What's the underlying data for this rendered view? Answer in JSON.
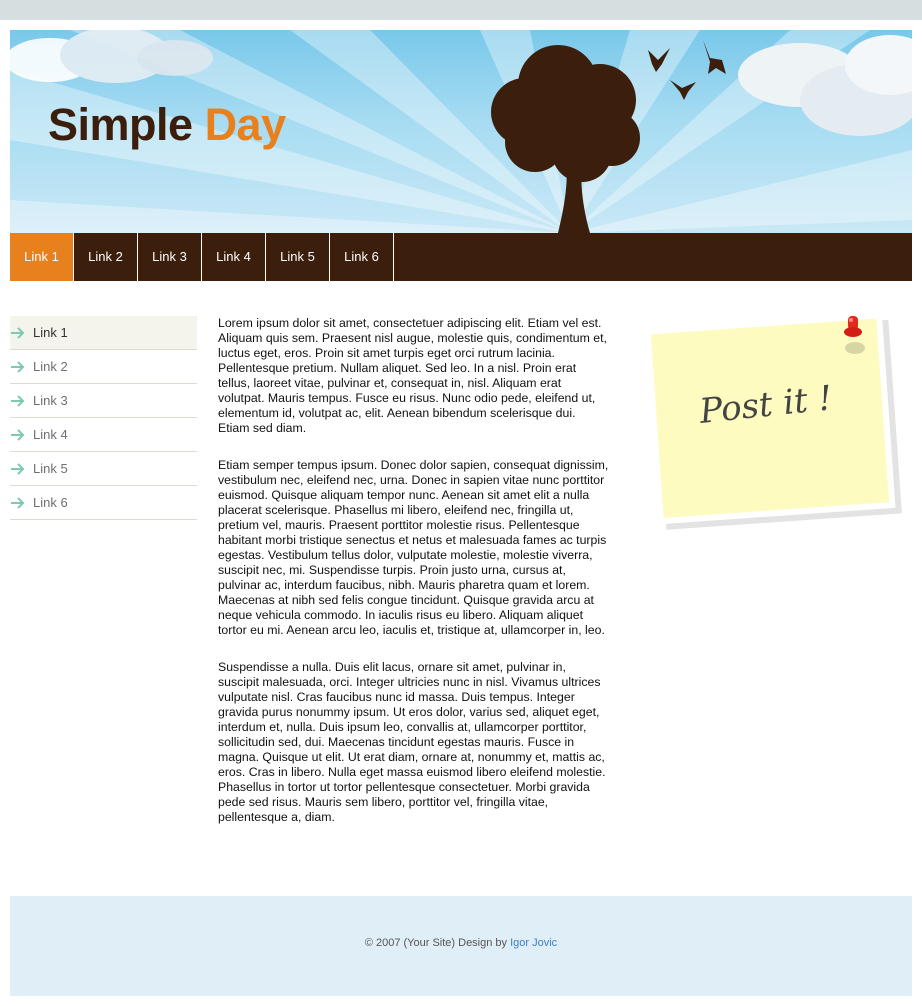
{
  "header": {
    "title_part1": "Simple",
    "title_part2": "Day",
    "colors": {
      "title_dark": "#3b1e0c",
      "title_accent": "#e8801e",
      "sky": "#79c8ea"
    },
    "decorations": [
      "sun-rays",
      "cloud-icon",
      "tree-icon",
      "bird-icon"
    ]
  },
  "nav": {
    "items": [
      {
        "label": "Link 1",
        "active": true
      },
      {
        "label": "Link 2",
        "active": false
      },
      {
        "label": "Link 3",
        "active": false
      },
      {
        "label": "Link 4",
        "active": false
      },
      {
        "label": "Link 5",
        "active": false
      },
      {
        "label": "Link 6",
        "active": false
      }
    ],
    "colors": {
      "bar": "#3b1e0c",
      "active": "#e8801e"
    }
  },
  "sidebar": {
    "items": [
      {
        "label": "Link 1",
        "active": true
      },
      {
        "label": "Link 2",
        "active": false
      },
      {
        "label": "Link 3",
        "active": false
      },
      {
        "label": "Link 4",
        "active": false
      },
      {
        "label": "Link 5",
        "active": false
      },
      {
        "label": "Link 6",
        "active": false
      }
    ],
    "icon": "arrow-right-icon"
  },
  "content": {
    "paragraphs": [
      "Lorem ipsum dolor sit amet, consectetuer adipiscing elit. Etiam vel est. Aliquam quis sem. Praesent nisl augue, molestie quis, condimentum et, luctus eget, eros. Proin sit amet turpis eget orci rutrum lacinia. Pellentesque pretium. Nullam aliquet. Sed leo. In a nisl. Proin erat tellus, laoreet vitae, pulvinar et, consequat in, nisl. Aliquam erat volutpat. Mauris tempus. Fusce eu risus. Nunc odio pede, eleifend ut, elementum id, volutpat ac, elit. Aenean bibendum scelerisque dui. Etiam sed diam.",
      "Etiam semper tempus ipsum. Donec dolor sapien, consequat dignissim, vestibulum nec, eleifend nec, urna. Donec in sapien vitae nunc porttitor euismod. Quisque aliquam tempor nunc. Aenean sit amet elit a nulla placerat scelerisque. Phasellus mi libero, eleifend nec, fringilla ut, pretium vel, mauris. Praesent porttitor molestie risus. Pellentesque habitant morbi tristique senectus et netus et malesuada fames ac turpis egestas. Vestibulum tellus dolor, vulputate molestie, molestie viverra, suscipit nec, mi. Suspendisse turpis. Proin justo urna, cursus at, pulvinar ac, interdum faucibus, nibh. Mauris pharetra quam et lorem. Maecenas at nibh sed felis congue tincidunt. Quisque gravida arcu at neque vehicula commodo. In iaculis risus eu libero. Aliquam aliquet tortor eu mi. Aenean arcu leo, iaculis et, tristique at, ullamcorper in, leo.",
      "Suspendisse a nulla. Duis elit lacus, ornare sit amet, pulvinar in, suscipit malesuada, orci. Integer ultricies nunc in nisl. Vivamus ultrices vulputate nisl. Cras faucibus nunc id massa. Duis tempus. Integer gravida purus nonummy ipsum. Ut eros dolor, varius sed, aliquet eget, interdum et, nulla. Duis ipsum leo, convallis at, ullamcorper porttitor, sollicitudin sed, dui. Maecenas tincidunt egestas mauris. Fusce in magna. Quisque ut elit. Ut erat diam, ornare at, nonummy et, mattis ac, eros. Cras in libero. Nulla eget massa euismod libero eleifend molestie. Phasellus in tortor ut tortor pellentesque consectetuer. Morbi gravida pede sed risus. Mauris sem libero, porttitor vel, fringilla vitae, pellentesque a, diam."
    ]
  },
  "postit": {
    "text": "Post it !",
    "icon": "pushpin-icon",
    "color": "#fdfbc0"
  },
  "footer": {
    "text": "© 2007 (Your Site) Design by",
    "link_label": "Igor Jovic",
    "colors": {
      "background": "#e0eef8",
      "link": "#3f7fbf"
    }
  }
}
